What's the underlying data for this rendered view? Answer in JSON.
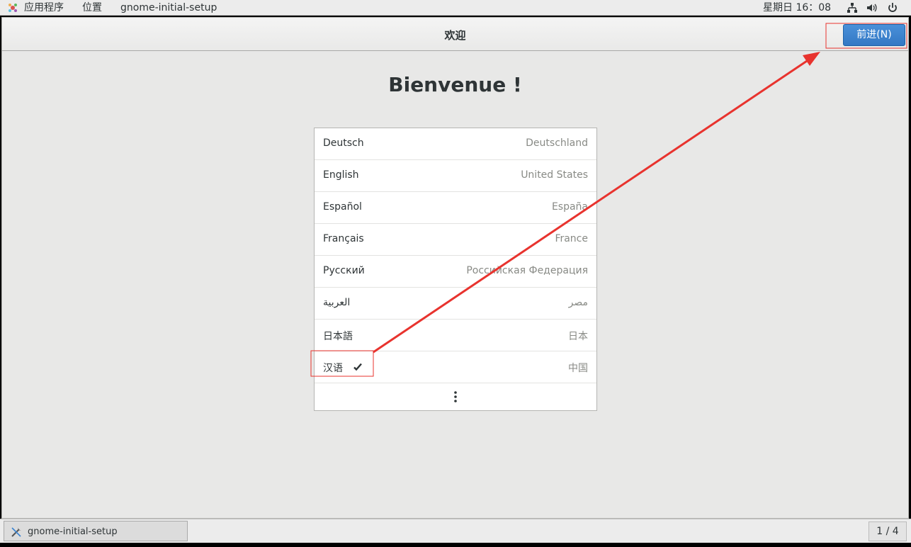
{
  "topbar": {
    "apps_menu": "应用程序",
    "places_menu": "位置",
    "window_menu": "gnome-initial-setup",
    "clock": "星期日 16：08",
    "icons": [
      "network-icon",
      "volume-icon",
      "power-icon"
    ]
  },
  "window": {
    "title": "欢迎",
    "next_button": "前进(N)",
    "heading": "Bienvenue !",
    "languages": [
      {
        "lang": "Deutsch",
        "region": "Deutschland"
      },
      {
        "lang": "English",
        "region": "United States"
      },
      {
        "lang": "Español",
        "region": "España"
      },
      {
        "lang": "Français",
        "region": "France"
      },
      {
        "lang": "Русский",
        "region": "Российская Федерация"
      },
      {
        "lang": "العربية",
        "region": "مصر"
      },
      {
        "lang": "日本語",
        "region": "日本"
      },
      {
        "lang": "汉语",
        "region": "中国",
        "selected": true
      }
    ],
    "more_icon": "more-vertical-icon"
  },
  "bottombar": {
    "task_label": "gnome-initial-setup",
    "workspace": "1 / 4"
  },
  "colors": {
    "accent": "#3a84d1",
    "annotation": "#e8332e"
  }
}
